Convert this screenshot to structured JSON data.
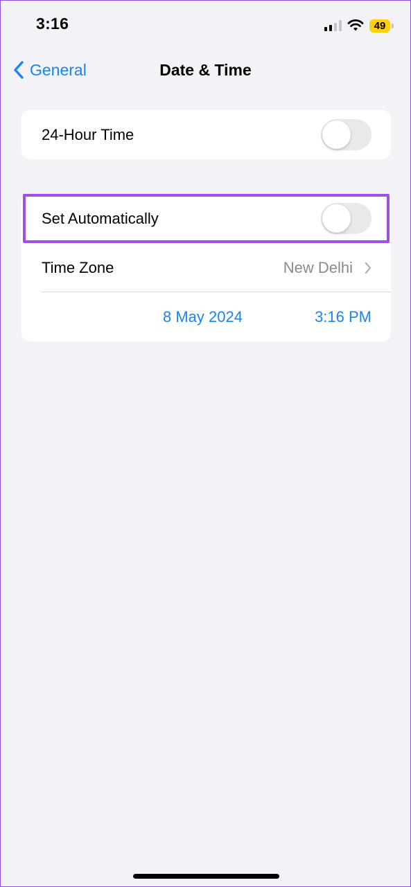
{
  "status_bar": {
    "time": "3:16",
    "battery_level": "49",
    "battery_color": "#fdd00b",
    "icons": [
      "signal-icon",
      "wifi-icon",
      "battery-icon"
    ]
  },
  "nav": {
    "back_label": "General",
    "title": "Date & Time",
    "accent_color": "#1a84f0"
  },
  "group1": {
    "hour24_label": "24-Hour Time",
    "hour24_on": false
  },
  "group2": {
    "set_auto_label": "Set Automatically",
    "set_auto_on": false,
    "timezone_label": "Time Zone",
    "timezone_value": "New Delhi",
    "date": "8 May 2024",
    "time": "3:16 PM"
  },
  "highlight_color": "#a24ee6"
}
